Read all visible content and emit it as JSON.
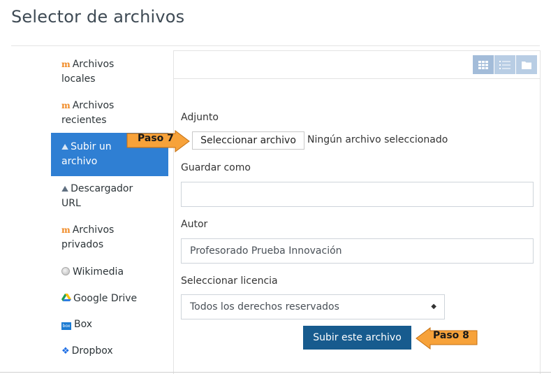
{
  "title": "Selector de archivos",
  "sidebar": {
    "items": [
      {
        "label": "Archivos locales",
        "line1": "Archivos",
        "line2": "locales",
        "icon": "moodle-icon"
      },
      {
        "label": "Archivos recientes",
        "line1": "Archivos",
        "line2": "recientes",
        "icon": "moodle-icon"
      },
      {
        "label": "Subir un archivo",
        "line1": "Subir un",
        "line2": "archivo",
        "icon": "upload-icon",
        "active": true
      },
      {
        "label": "Descargador URL",
        "line1": "Descargador",
        "line2": "URL",
        "icon": "url-downloader-icon"
      },
      {
        "label": "Archivos privados",
        "line1": "Archivos",
        "line2": "privados",
        "icon": "moodle-icon"
      },
      {
        "label": "Wikimedia",
        "line1": "Wikimedia",
        "icon": "wikimedia-icon"
      },
      {
        "label": "Google Drive",
        "line1": "Google Drive",
        "icon": "google-drive-icon"
      },
      {
        "label": "Box",
        "line1": "Box",
        "icon": "box-icon"
      },
      {
        "label": "Dropbox",
        "line1": "Dropbox",
        "icon": "dropbox-icon"
      }
    ]
  },
  "toolbar": {
    "view_buttons": [
      "grid-view-icon",
      "list-view-icon",
      "folder-view-icon"
    ]
  },
  "form": {
    "attachment_label": "Adjunto",
    "choose_file_button": "Seleccionar archivo",
    "no_file_text": "Ningún archivo seleccionado",
    "save_as_label": "Guardar como",
    "save_as_value": "",
    "author_label": "Autor",
    "author_value": "Profesorado Prueba Innovación",
    "license_label": "Seleccionar licencia",
    "license_value": "Todos los derechos reservados",
    "submit_button": "Subir este archivo"
  },
  "annotations": {
    "step7": "Paso 7",
    "step8": "Paso 8"
  },
  "colors": {
    "active_item": "#2f7fd3",
    "submit_button": "#175b8e",
    "callout_fill": "#f7a23a",
    "view_button": "#b8cde4"
  }
}
